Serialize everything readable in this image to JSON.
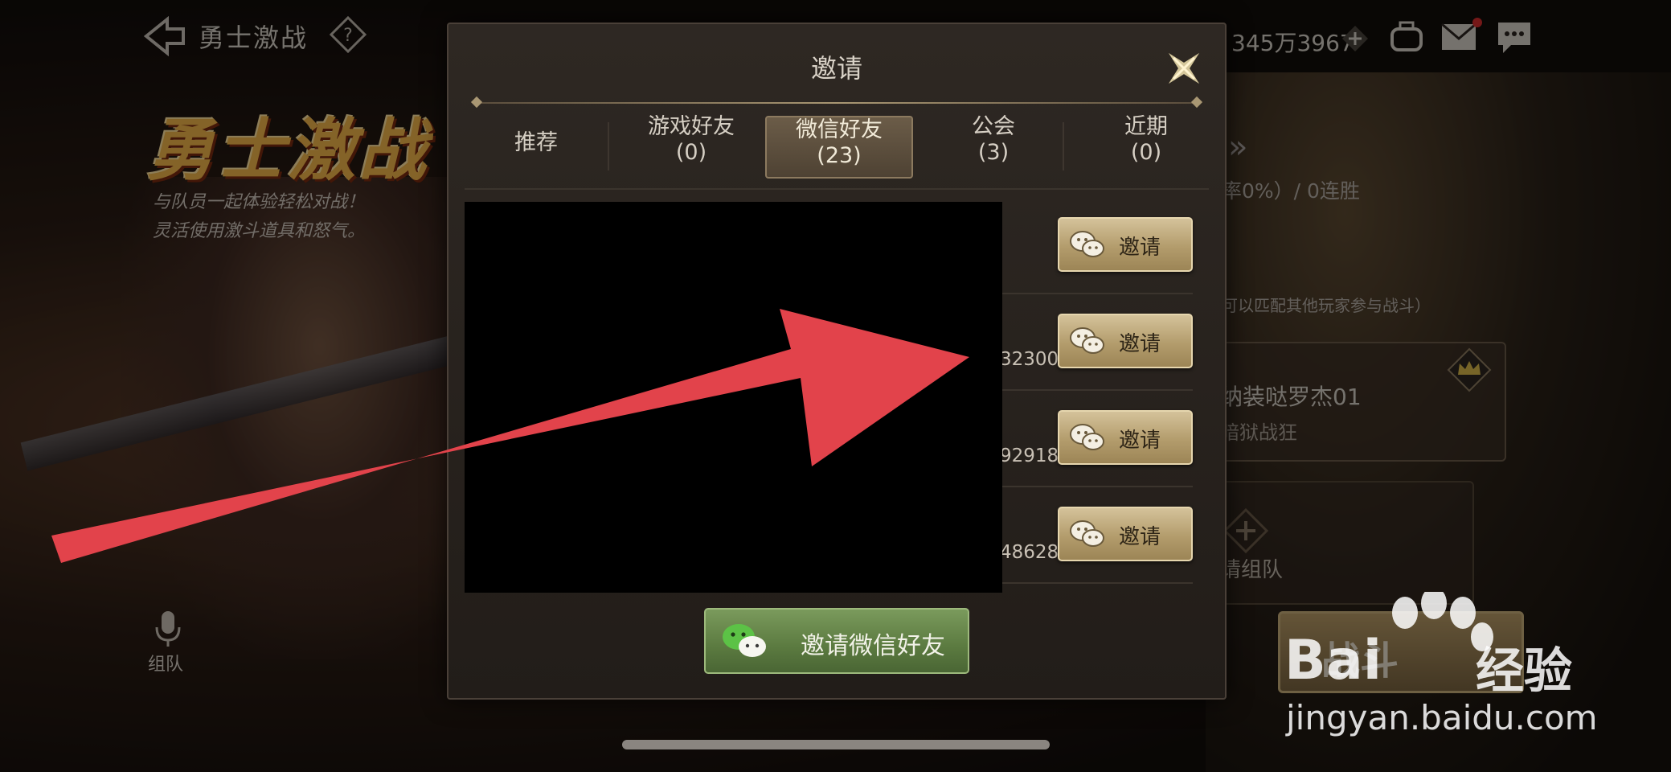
{
  "header": {
    "title": "勇士激战",
    "currency": "345万3967"
  },
  "event": {
    "banner": "勇士激战",
    "desc_line1": "与队员一起体验轻松对战！",
    "desc_line2": "灵活使用激斗道具和怒气。"
  },
  "left_nav": {
    "team_label": "组队"
  },
  "right_panel": {
    "arrows": "»",
    "stat": "率0%）/ 0连胜",
    "hint": "可以匹配其他玩家参与战斗）",
    "player_name": "纳装哒罗杰01",
    "player_class": "暗狱战狂",
    "invite_team": "请组队",
    "battle_button": "战斗"
  },
  "dialog": {
    "title": "邀请",
    "tabs": [
      {
        "label": "推荐",
        "count": ""
      },
      {
        "label": "游戏好友",
        "count": "(0)"
      },
      {
        "label": "微信好友",
        "count": "(23)"
      },
      {
        "label": "公会",
        "count": "(3)"
      },
      {
        "label": "近期",
        "count": "(0)"
      }
    ],
    "active_tab": "微信好友",
    "rows": [
      {
        "id_partial": "",
        "invite_label": "邀请"
      },
      {
        "id_partial": "32300",
        "invite_label": "邀请"
      },
      {
        "id_partial": "92918",
        "invite_label": "邀请"
      },
      {
        "id_partial": "48628",
        "invite_label": "邀请"
      }
    ],
    "invite_wechat_button": "邀请微信好友"
  },
  "watermark": {
    "brand": "Bai",
    "brand_suffix": "经验",
    "url": "jingyan.baidu.com"
  },
  "colors": {
    "annotation_arrow": "#e2434b",
    "invite_button": "#c4b07f",
    "wechat_button": "#5f7f44"
  }
}
